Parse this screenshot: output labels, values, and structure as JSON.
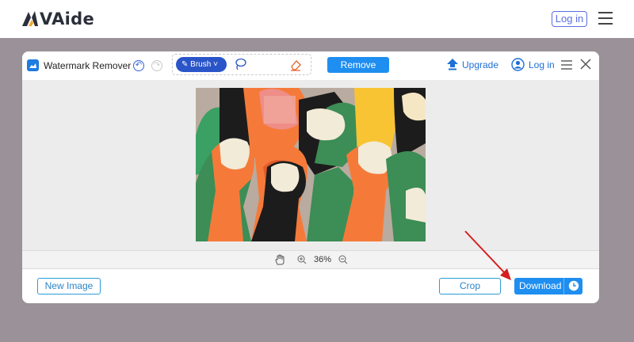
{
  "site": {
    "brand": "VAide",
    "login_label": "Log in"
  },
  "modal": {
    "title": "Watermark Remover",
    "brush_label": "Brush",
    "remove_label": "Remove",
    "upgrade_label": "Upgrade",
    "login_label": "Log in",
    "zoom_value": "36%",
    "new_image_label": "New Image",
    "crop_label": "Crop",
    "download_label": "Download"
  },
  "icons": [
    "logo-icon",
    "menu-icon",
    "app-icon",
    "undo-icon",
    "redo-icon",
    "brush-icon",
    "chevron-down-icon",
    "lasso-icon",
    "eraser-icon",
    "upload-arrow-icon",
    "user-icon",
    "close-icon",
    "hand-icon",
    "zoom-in-icon",
    "zoom-out-icon",
    "clock-icon"
  ],
  "colors": {
    "accent": "#1e8ef0",
    "brush": "#2a55c9",
    "link": "#1e6fd6",
    "arrow": "#d42020"
  }
}
